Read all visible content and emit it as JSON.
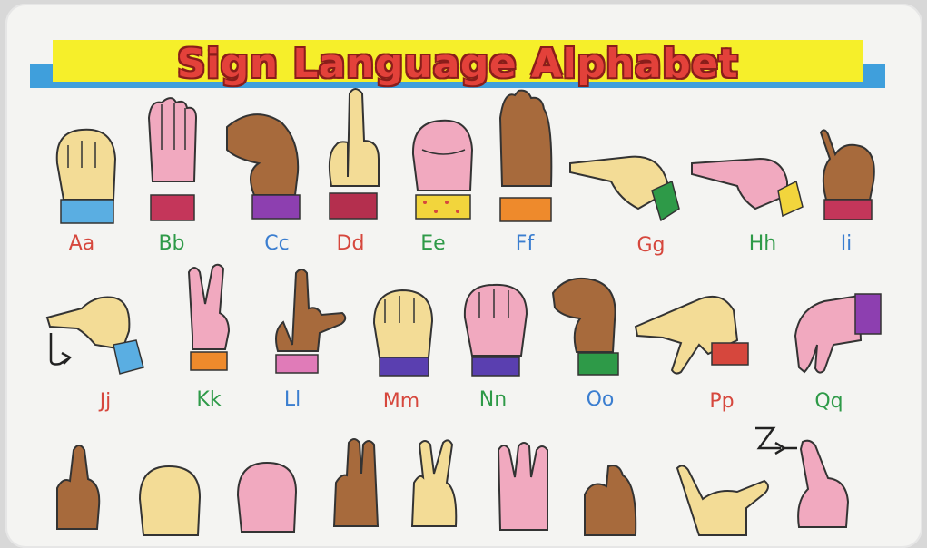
{
  "title": "Sign Language Alphabet",
  "letters": [
    {
      "text": "Aa",
      "color": "#d6473d"
    },
    {
      "text": "Bb",
      "color": "#2e9a48"
    },
    {
      "text": "Cc",
      "color": "#3b7ed0"
    },
    {
      "text": "Dd",
      "color": "#d6473d"
    },
    {
      "text": "Ee",
      "color": "#2e9a48"
    },
    {
      "text": "Ff",
      "color": "#3b7ed0"
    },
    {
      "text": "Gg",
      "color": "#d6473d"
    },
    {
      "text": "Hh",
      "color": "#2e9a48"
    },
    {
      "text": "Ii",
      "color": "#3b7ed0"
    },
    {
      "text": "Jj",
      "color": "#d6473d"
    },
    {
      "text": "Kk",
      "color": "#2e9a48"
    },
    {
      "text": "Ll",
      "color": "#3b7ed0"
    },
    {
      "text": "Mm",
      "color": "#d6473d"
    },
    {
      "text": "Nn",
      "color": "#2e9a48"
    },
    {
      "text": "Oo",
      "color": "#3b7ed0"
    },
    {
      "text": "Pp",
      "color": "#d6473d"
    },
    {
      "text": "Qq",
      "color": "#2e9a48"
    }
  ],
  "colors": {
    "title_fill": "#e3413a",
    "yellow_band": "#f6ef2a",
    "blue_band": "#3f9fdc",
    "skin_light": "#f3dc96",
    "skin_pink": "#f1a9bf",
    "skin_brown": "#a76a3c"
  }
}
